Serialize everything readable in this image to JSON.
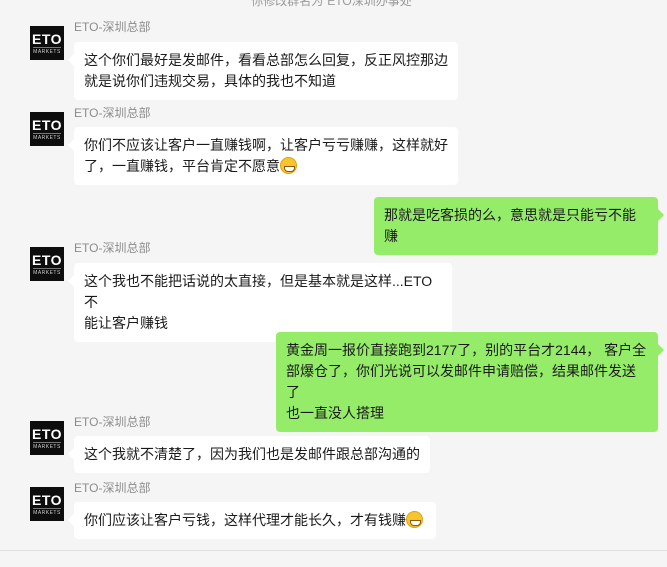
{
  "system_notice": "你修改群名为“ETO深圳办事处”",
  "contact": {
    "name": "ETO-深圳总部",
    "avatar_main": "ETO",
    "avatar_sub": "MARKETS"
  },
  "messages": [
    {
      "side": "left",
      "sender": "ETO-深圳总部",
      "lines": [
        "这个你们最好是发邮件，看看总部怎么回复，反正风控那边",
        "就是说你们违规交易，具体的我也不知道"
      ],
      "emoji": ""
    },
    {
      "side": "left",
      "sender": "ETO-深圳总部",
      "lines": [
        "你们不应该让客户一直赚钱啊，让客户亏亏赚赚，这样就好",
        "了，一直赚钱，平台肯定不愿意"
      ],
      "emoji": "grin-emoji"
    },
    {
      "side": "right",
      "lines": [
        "那就是吃客损的么，意思就是只能亏不能赚"
      ]
    },
    {
      "side": "left",
      "sender": "ETO-深圳总部",
      "lines": [
        "这个我也不能把话说的太直接，但是基本就是这样...ETO不",
        "能让客户赚钱"
      ],
      "emoji": ""
    },
    {
      "side": "right",
      "lines": [
        "黄金周一报价直接跑到2177了，别的平台才2144， 客户全",
        "部爆仓了，你们光说可以发邮件申请赔偿，结果邮件发送了",
        "也一直没人搭理"
      ]
    },
    {
      "side": "left",
      "sender": "ETO-深圳总部",
      "lines": [
        "这个我就不清楚了，因为我们也是发邮件跟总部沟通的"
      ],
      "emoji": ""
    },
    {
      "side": "left",
      "sender": "ETO-深圳总部",
      "lines": [
        "你们应该让客户亏钱，这样代理才能长久，才有钱赚"
      ],
      "emoji": "grin-emoji"
    }
  ],
  "colors": {
    "background": "#f5f5f5",
    "left_bubble": "#ffffff",
    "right_bubble": "#95ec69",
    "avatar_bg": "#0d0d0d"
  }
}
